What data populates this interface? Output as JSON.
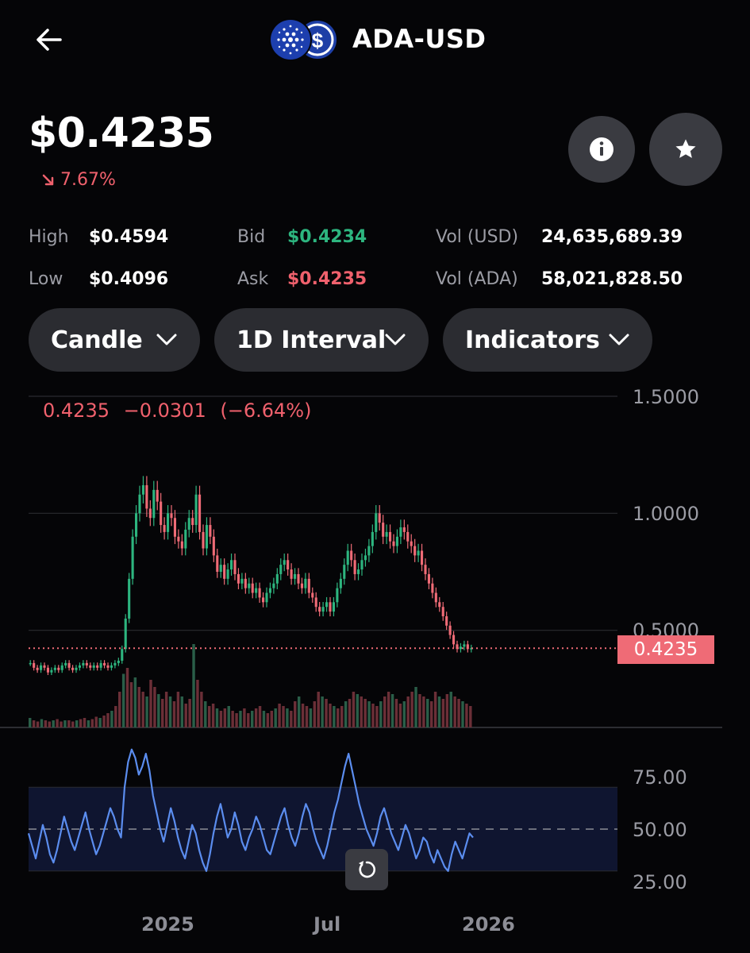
{
  "header": {
    "back_icon": "arrow-left-icon",
    "title": "ADA-USD",
    "logo_icons": [
      "cardano-icon",
      "dollar-icon"
    ]
  },
  "quote": {
    "price": "$0.4235",
    "change": "7.67%",
    "change_direction": "down",
    "info_icon": "info-icon",
    "favorite_icon": "star-icon"
  },
  "stats": {
    "high_label": "High",
    "high_value": "$0.4594",
    "low_label": "Low",
    "low_value": "$0.4096",
    "bid_label": "Bid",
    "bid_value": "$0.4234",
    "ask_label": "Ask",
    "ask_value": "$0.4235",
    "vol_usd_label": "Vol (USD)",
    "vol_usd_value": "24,635,689.39",
    "vol_ada_label": "Vol (ADA)",
    "vol_ada_value": "58,021,828.50"
  },
  "controls": {
    "chart_type": "Candle",
    "interval": "1D Interval",
    "indicators": "Indicators"
  },
  "chart_data": [
    {
      "type": "candlestick",
      "readout": {
        "last": "0.4235",
        "change": "−0.0301",
        "change_pct": "(−6.64%)"
      },
      "last_price_label": "0.4235",
      "last_price": 0.4235,
      "y_ticks": [
        "1.5000",
        "1.0000",
        "0.5000"
      ],
      "ylim": [
        0,
        1.5
      ],
      "x_ticks": [
        "2025",
        "Jul",
        "2026"
      ],
      "colors": {
        "up": "#2db57f",
        "down": "#ef6b76",
        "last_line": "#ef6b76"
      },
      "series": [
        {
          "values": [
            0.36,
            0.34,
            0.33,
            0.35,
            0.34,
            0.32,
            0.33,
            0.34,
            0.33,
            0.35,
            0.36,
            0.34,
            0.33,
            0.34,
            0.35,
            0.36,
            0.35,
            0.34,
            0.35,
            0.34,
            0.36,
            0.35,
            0.34,
            0.35,
            0.36,
            0.37,
            0.42,
            0.55,
            0.72,
            0.9,
            1.0,
            1.08,
            1.12,
            1.02,
            0.98,
            1.1,
            1.05,
            0.95,
            0.92,
            1.0,
            0.98,
            0.9,
            0.88,
            0.85,
            0.93,
            0.98,
            0.95,
            1.08,
            0.92,
            0.85,
            0.95,
            0.9,
            0.82,
            0.75,
            0.78,
            0.72,
            0.76,
            0.8,
            0.74,
            0.7,
            0.72,
            0.68,
            0.7,
            0.66,
            0.68,
            0.64,
            0.62,
            0.66,
            0.68,
            0.7,
            0.74,
            0.78,
            0.8,
            0.76,
            0.72,
            0.74,
            0.7,
            0.68,
            0.72,
            0.66,
            0.64,
            0.6,
            0.58,
            0.6,
            0.62,
            0.58,
            0.62,
            0.68,
            0.72,
            0.78,
            0.84,
            0.8,
            0.74,
            0.76,
            0.8,
            0.82,
            0.86,
            0.92,
            1.0,
            0.96,
            0.9,
            0.92,
            0.88,
            0.86,
            0.9,
            0.94,
            0.92,
            0.88,
            0.86,
            0.82,
            0.84,
            0.78,
            0.74,
            0.7,
            0.66,
            0.62,
            0.6,
            0.56,
            0.52,
            0.48,
            0.44,
            0.42,
            0.43,
            0.44,
            0.42,
            0.4235
          ]
        }
      ],
      "volume": [
        8,
        6,
        5,
        7,
        6,
        5,
        6,
        7,
        5,
        6,
        6,
        5,
        6,
        7,
        8,
        6,
        7,
        9,
        8,
        10,
        12,
        14,
        18,
        30,
        45,
        50,
        38,
        42,
        34,
        30,
        26,
        40,
        34,
        28,
        24,
        30,
        26,
        22,
        30,
        26,
        20,
        24,
        70,
        40,
        30,
        22,
        18,
        20,
        16,
        14,
        16,
        18,
        14,
        12,
        14,
        16,
        12,
        14,
        16,
        18,
        14,
        12,
        14,
        16,
        20,
        18,
        16,
        14,
        22,
        26,
        20,
        18,
        16,
        22,
        30,
        26,
        24,
        20,
        18,
        16,
        18,
        22,
        24,
        30,
        28,
        26,
        24,
        22,
        20,
        18,
        22,
        26,
        30,
        28,
        24,
        20,
        22,
        26,
        30,
        34,
        28,
        26,
        24,
        22,
        30,
        26,
        24,
        28,
        30,
        26,
        24,
        22,
        20,
        18
      ],
      "oscillator": {
        "y_ticks": [
          "75.00",
          "50.00",
          "25.00"
        ],
        "ylim": [
          15,
          100
        ],
        "midline": 50,
        "band": [
          30,
          70
        ],
        "values": [
          48,
          42,
          36,
          44,
          52,
          46,
          38,
          34,
          40,
          48,
          56,
          50,
          44,
          40,
          46,
          52,
          58,
          50,
          44,
          38,
          42,
          48,
          54,
          60,
          56,
          50,
          46,
          70,
          82,
          88,
          84,
          76,
          80,
          86,
          78,
          66,
          58,
          50,
          44,
          52,
          60,
          54,
          46,
          40,
          36,
          44,
          52,
          48,
          40,
          34,
          30,
          38,
          48,
          56,
          62,
          54,
          46,
          50,
          58,
          52,
          44,
          40,
          46,
          50,
          56,
          52,
          46,
          40,
          38,
          44,
          50,
          56,
          60,
          52,
          46,
          42,
          48,
          56,
          62,
          58,
          50,
          44,
          40,
          36,
          42,
          50,
          58,
          64,
          72,
          80,
          86,
          78,
          70,
          62,
          56,
          50,
          46,
          42,
          48,
          56,
          60,
          54,
          48,
          44,
          40,
          46,
          52,
          48,
          42,
          36,
          40,
          46,
          44,
          38,
          34,
          40,
          36,
          32,
          30,
          38,
          44,
          40,
          36,
          42,
          48,
          46
        ]
      }
    }
  ],
  "chart_controls": {
    "reset_icon": "reset-zoom-icon"
  }
}
